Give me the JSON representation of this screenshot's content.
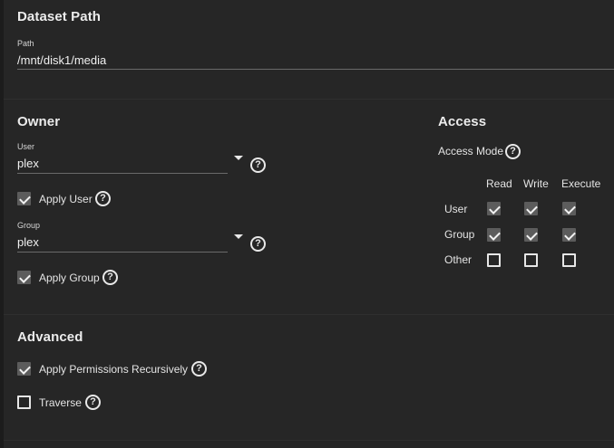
{
  "dataset": {
    "title": "Dataset Path",
    "path_label": "Path",
    "path_value": "/mnt/disk1/media"
  },
  "owner": {
    "title": "Owner",
    "user_label": "User",
    "user_value": "plex",
    "apply_user_label": "Apply User",
    "apply_user_checked": true,
    "group_label": "Group",
    "group_value": "plex",
    "apply_group_label": "Apply Group",
    "apply_group_checked": true
  },
  "access": {
    "title": "Access",
    "mode_label": "Access Mode",
    "columns": [
      "Read",
      "Write",
      "Execute"
    ],
    "rows": [
      {
        "label": "User",
        "values": [
          true,
          true,
          true
        ]
      },
      {
        "label": "Group",
        "values": [
          true,
          true,
          true
        ]
      },
      {
        "label": "Other",
        "values": [
          false,
          false,
          false
        ]
      }
    ]
  },
  "advanced": {
    "title": "Advanced",
    "recursive_label": "Apply Permissions Recursively",
    "recursive_checked": true,
    "traverse_label": "Traverse",
    "traverse_checked": false
  },
  "icons": {
    "help": "help-circle-icon",
    "dropdown": "caret-down-icon",
    "check": "check-icon"
  },
  "colors": {
    "background": "#262626",
    "checked_fill": "#5c5c5c",
    "text": "#e6e6e6"
  }
}
